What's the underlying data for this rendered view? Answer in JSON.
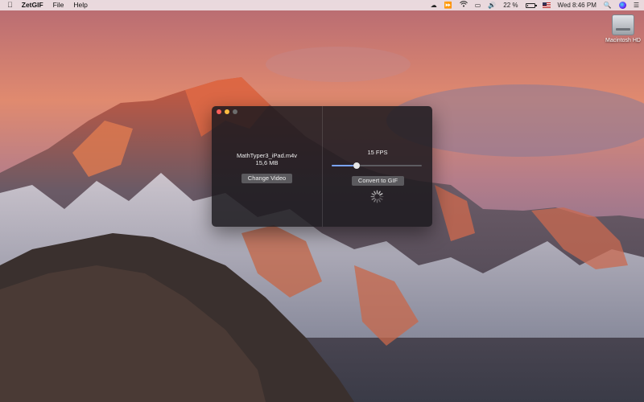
{
  "menubar": {
    "apple_icon": "apple-icon",
    "app_name": "ZetGIF",
    "menus": [
      "File",
      "Help"
    ],
    "status": {
      "battery_percent": "22 %",
      "battery_level": 0.22,
      "clock": "Wed 8:46 PM",
      "icons": [
        "cloud-sync-icon",
        "fast-forward-icon",
        "wifi-icon",
        "airplay-icon",
        "volume-icon",
        "battery-icon",
        "us-flag-icon",
        "search-icon",
        "siri-icon",
        "notification-center-icon"
      ]
    }
  },
  "desktop": {
    "drive_label": "Macintosh HD"
  },
  "window": {
    "file_name": "MathTyper3_iPad.m4v",
    "file_size": "15,6 MB",
    "change_video_label": "Change Video",
    "fps_label": "15 FPS",
    "fps_slider_value": 0.28,
    "convert_label": "Convert to GIF",
    "spinner_icon": "spinner-icon"
  },
  "colors": {
    "close": "#fc605b",
    "minimize": "#fdbc40",
    "accent": "#7aa4ff"
  }
}
